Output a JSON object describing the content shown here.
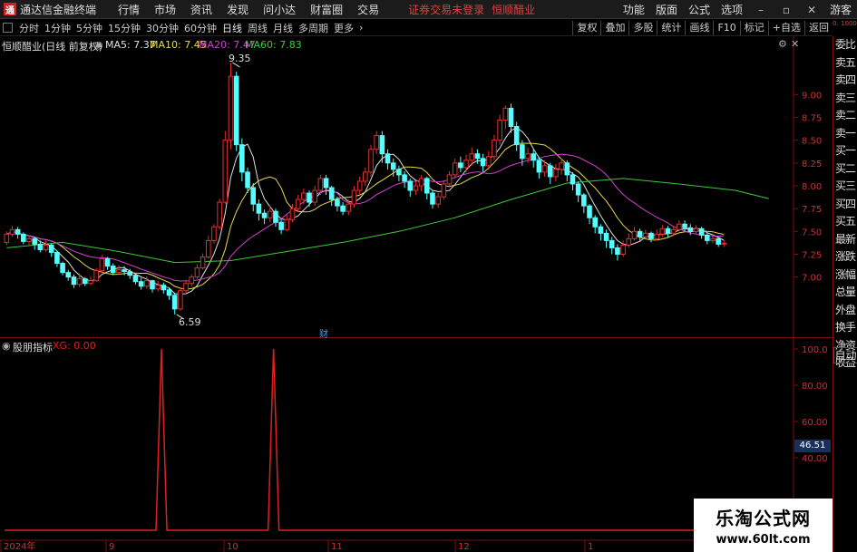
{
  "menubar": {
    "logo_glyph": "通",
    "app_title": "通达信金融终端",
    "items": [
      "行情",
      "市场",
      "资讯",
      "发现",
      "问小达",
      "财富圈",
      "交易"
    ],
    "login_text": "证券交易未登录",
    "stock_name": "恒顺醋业",
    "right_items": [
      "功能",
      "版面",
      "公式",
      "选项"
    ],
    "guest": "游客",
    "accent": "#e04040"
  },
  "tabbar": {
    "periods": [
      "分时",
      "1分钟",
      "5分钟",
      "15分钟",
      "30分钟",
      "60分钟",
      "日线",
      "周线",
      "月线",
      "多周期",
      "更多"
    ],
    "active": "日线",
    "tools": [
      "复权",
      "叠加",
      "多股",
      "统计",
      "画线",
      "F10",
      "标记",
      "+自选",
      "返回"
    ]
  },
  "main_chart": {
    "title": "恒顺醋业(日线 前复权)",
    "ma_labels": [
      {
        "text": "MA5: 7.37",
        "color": "#e0e0e0"
      },
      {
        "text": "MA10: 7.45",
        "color": "#e8d84a"
      },
      {
        "text": "MA20: 7.47",
        "color": "#d23ed2"
      },
      {
        "text": "MA60: 7.83",
        "color": "#3ec83e"
      }
    ],
    "high_label": "9.35",
    "low_label": "6.59",
    "news_marker": "财",
    "y_ticks": [
      "9.00",
      "8.75",
      "8.50",
      "8.25",
      "8.00",
      "7.75",
      "7.50",
      "7.25",
      "7.00"
    ],
    "up_color": "#e03030",
    "down_color": "#54ffff"
  },
  "indicator": {
    "name": "股朋指标",
    "value_label": "XG: 0.00",
    "y_ticks": [
      "100.0",
      "80.00",
      "60.00",
      "40.00"
    ],
    "current_value": "46.51",
    "line_color": "#e02020"
  },
  "xaxis": {
    "labels": [
      "2024年",
      "9",
      "10",
      "11",
      "12",
      "1"
    ]
  },
  "right_panel": {
    "top_text": "0.\n1000",
    "items": [
      "委比",
      "卖五",
      "卖四",
      "卖三",
      "卖二",
      "卖一",
      "买一",
      "买二",
      "买三",
      "买四",
      "买五",
      "最新",
      "涨跌",
      "涨幅",
      "总量",
      "外盘",
      "换手",
      "净资",
      "收益"
    ],
    "auto_label": "自动"
  },
  "watermark": {
    "title": "乐淘公式网",
    "url": "www.60lt.com"
  },
  "chart_data": {
    "type": "candlestick",
    "ylim": [
      6.5,
      9.45
    ],
    "candles": [
      [
        7.38,
        7.47,
        7.5,
        7.35
      ],
      [
        7.47,
        7.52,
        7.56,
        7.44
      ],
      [
        7.52,
        7.47,
        7.55,
        7.42
      ],
      [
        7.47,
        7.39,
        7.49,
        7.36
      ],
      [
        7.39,
        7.42,
        7.45,
        7.34
      ],
      [
        7.42,
        7.36,
        7.44,
        7.3
      ],
      [
        7.36,
        7.3,
        7.4,
        7.27
      ],
      [
        7.3,
        7.35,
        7.4,
        7.28
      ],
      [
        7.35,
        7.27,
        7.37,
        7.22
      ],
      [
        7.27,
        7.15,
        7.29,
        7.11
      ],
      [
        7.15,
        7.05,
        7.17,
        7.02
      ],
      [
        7.05,
        7.0,
        7.08,
        6.96
      ],
      [
        7.0,
        6.92,
        7.03,
        6.88
      ],
      [
        6.92,
        6.98,
        7.04,
        6.89
      ],
      [
        6.98,
        6.93,
        7.0,
        6.9
      ],
      [
        6.93,
        6.96,
        7.01,
        6.91
      ],
      [
        6.96,
        7.07,
        7.1,
        6.95
      ],
      [
        7.07,
        7.2,
        7.24,
        7.05
      ],
      [
        7.2,
        7.12,
        7.22,
        7.08
      ],
      [
        7.12,
        7.05,
        7.15,
        7.02
      ],
      [
        7.05,
        7.08,
        7.13,
        7.03
      ],
      [
        7.08,
        7.06,
        7.12,
        7.02
      ],
      [
        7.06,
        7.02,
        7.09,
        6.98
      ],
      [
        7.02,
        6.95,
        7.04,
        6.92
      ],
      [
        6.95,
        6.9,
        6.99,
        6.86
      ],
      [
        6.9,
        6.96,
        7.01,
        6.87
      ],
      [
        6.96,
        6.87,
        6.97,
        6.83
      ],
      [
        6.87,
        6.91,
        6.96,
        6.84
      ],
      [
        6.91,
        6.86,
        6.94,
        6.82
      ],
      [
        6.86,
        6.8,
        6.88,
        6.75
      ],
      [
        6.8,
        6.65,
        6.83,
        6.59
      ],
      [
        6.65,
        6.85,
        6.88,
        6.63
      ],
      [
        6.85,
        6.93,
        6.97,
        6.83
      ],
      [
        6.93,
        7.0,
        7.03,
        6.9
      ],
      [
        7.0,
        7.1,
        7.14,
        6.98
      ],
      [
        7.1,
        7.22,
        7.26,
        7.08
      ],
      [
        7.22,
        7.4,
        7.45,
        7.2
      ],
      [
        7.4,
        7.55,
        7.58,
        7.37
      ],
      [
        7.55,
        7.82,
        7.86,
        7.52
      ],
      [
        7.82,
        8.5,
        8.6,
        7.8
      ],
      [
        8.5,
        9.2,
        9.35,
        8.4
      ],
      [
        9.2,
        8.45,
        9.25,
        8.38
      ],
      [
        8.45,
        8.15,
        8.52,
        8.05
      ],
      [
        8.15,
        7.98,
        8.2,
        7.92
      ],
      [
        7.98,
        7.8,
        8.03,
        7.72
      ],
      [
        7.8,
        7.7,
        7.85,
        7.62
      ],
      [
        7.7,
        7.65,
        7.74,
        7.58
      ],
      [
        7.65,
        7.72,
        7.78,
        7.6
      ],
      [
        7.72,
        7.6,
        7.75,
        7.55
      ],
      [
        7.6,
        7.52,
        7.63,
        7.47
      ],
      [
        7.52,
        7.63,
        7.68,
        7.5
      ],
      [
        7.63,
        7.75,
        7.8,
        7.6
      ],
      [
        7.75,
        7.85,
        7.9,
        7.72
      ],
      [
        7.85,
        7.92,
        7.97,
        7.8
      ],
      [
        7.92,
        7.82,
        7.95,
        7.77
      ],
      [
        7.82,
        7.95,
        8.0,
        7.78
      ],
      [
        7.95,
        8.08,
        8.12,
        7.9
      ],
      [
        8.08,
        7.98,
        8.12,
        7.9
      ],
      [
        7.98,
        7.85,
        8.0,
        7.78
      ],
      [
        7.85,
        7.78,
        7.88,
        7.72
      ],
      [
        7.78,
        7.72,
        7.82,
        7.68
      ],
      [
        7.72,
        7.8,
        7.85,
        7.68
      ],
      [
        7.8,
        7.95,
        8.0,
        7.76
      ],
      [
        7.95,
        8.05,
        8.1,
        7.9
      ],
      [
        8.05,
        8.15,
        8.2,
        8.0
      ],
      [
        8.15,
        8.4,
        8.45,
        8.1
      ],
      [
        8.4,
        8.55,
        8.6,
        8.35
      ],
      [
        8.55,
        8.35,
        8.6,
        8.25
      ],
      [
        8.35,
        8.25,
        8.4,
        8.18
      ],
      [
        8.25,
        8.18,
        8.3,
        8.1
      ],
      [
        8.18,
        8.12,
        8.22,
        8.05
      ],
      [
        8.12,
        8.05,
        8.16,
        7.98
      ],
      [
        8.05,
        7.95,
        8.08,
        7.88
      ],
      [
        7.95,
        8.0,
        8.05,
        7.9
      ],
      [
        8.0,
        8.08,
        8.12,
        7.94
      ],
      [
        8.08,
        7.92,
        8.1,
        7.85
      ],
      [
        7.92,
        7.8,
        7.95,
        7.75
      ],
      [
        7.8,
        7.88,
        7.92,
        7.76
      ],
      [
        7.88,
        8.02,
        8.06,
        7.85
      ],
      [
        8.02,
        8.12,
        8.16,
        7.98
      ],
      [
        8.12,
        8.25,
        8.3,
        8.08
      ],
      [
        8.25,
        8.2,
        8.32,
        8.15
      ],
      [
        8.2,
        8.28,
        8.34,
        8.15
      ],
      [
        8.28,
        8.35,
        8.42,
        8.22
      ],
      [
        8.35,
        8.3,
        8.4,
        8.24
      ],
      [
        8.3,
        8.22,
        8.35,
        8.15
      ],
      [
        8.22,
        8.32,
        8.38,
        8.18
      ],
      [
        8.32,
        8.5,
        8.56,
        8.28
      ],
      [
        8.5,
        8.72,
        8.78,
        8.45
      ],
      [
        8.72,
        8.85,
        8.88,
        8.62
      ],
      [
        8.85,
        8.65,
        8.9,
        8.58
      ],
      [
        8.65,
        8.45,
        8.7,
        8.38
      ],
      [
        8.45,
        8.3,
        8.5,
        8.22
      ],
      [
        8.3,
        8.35,
        8.42,
        8.25
      ],
      [
        8.35,
        8.28,
        8.4,
        8.2
      ],
      [
        8.28,
        8.15,
        8.32,
        8.08
      ],
      [
        8.15,
        8.22,
        8.28,
        8.1
      ],
      [
        8.22,
        8.1,
        8.25,
        8.02
      ],
      [
        8.1,
        8.18,
        8.24,
        8.05
      ],
      [
        8.18,
        8.25,
        8.3,
        8.12
      ],
      [
        8.25,
        8.12,
        8.28,
        8.05
      ],
      [
        8.12,
        8.02,
        8.15,
        7.95
      ],
      [
        8.02,
        7.9,
        8.05,
        7.82
      ],
      [
        7.9,
        7.78,
        7.92,
        7.7
      ],
      [
        7.78,
        7.65,
        7.8,
        7.58
      ],
      [
        7.65,
        7.55,
        7.68,
        7.48
      ],
      [
        7.55,
        7.48,
        7.58,
        7.4
      ],
      [
        7.48,
        7.4,
        7.52,
        7.32
      ],
      [
        7.4,
        7.32,
        7.44,
        7.25
      ],
      [
        7.32,
        7.25,
        7.36,
        7.18
      ],
      [
        7.25,
        7.35,
        7.4,
        7.22
      ],
      [
        7.35,
        7.42,
        7.48,
        7.32
      ],
      [
        7.42,
        7.5,
        7.55,
        7.4
      ],
      [
        7.5,
        7.44,
        7.53,
        7.4
      ],
      [
        7.44,
        7.48,
        7.52,
        7.42
      ],
      [
        7.48,
        7.42,
        7.5,
        7.38
      ],
      [
        7.42,
        7.47,
        7.52,
        7.4
      ],
      [
        7.47,
        7.53,
        7.57,
        7.44
      ],
      [
        7.53,
        7.48,
        7.56,
        7.44
      ],
      [
        7.48,
        7.52,
        7.56,
        7.45
      ],
      [
        7.52,
        7.58,
        7.62,
        7.5
      ],
      [
        7.58,
        7.54,
        7.62,
        7.5
      ],
      [
        7.54,
        7.5,
        7.58,
        7.46
      ],
      [
        7.5,
        7.53,
        7.57,
        7.47
      ],
      [
        7.53,
        7.46,
        7.55,
        7.42
      ],
      [
        7.46,
        7.4,
        7.49,
        7.36
      ],
      [
        7.4,
        7.42,
        7.46,
        7.37
      ],
      [
        7.42,
        7.36,
        7.44,
        7.33
      ],
      [
        7.36,
        7.37,
        7.4,
        7.33
      ]
    ],
    "ma60": [
      [
        0,
        7.32
      ],
      [
        10,
        7.38
      ],
      [
        20,
        7.28
      ],
      [
        30,
        7.16
      ],
      [
        40,
        7.18
      ],
      [
        50,
        7.28
      ],
      [
        60,
        7.38
      ],
      [
        70,
        7.5
      ],
      [
        80,
        7.65
      ],
      [
        90,
        7.85
      ],
      [
        100,
        8.03
      ],
      [
        110,
        8.08
      ],
      [
        120,
        8.02
      ],
      [
        130,
        7.95
      ],
      [
        136,
        7.86
      ]
    ],
    "xg_spikes": [
      28,
      48,
      171
    ],
    "xg_max": 100
  }
}
